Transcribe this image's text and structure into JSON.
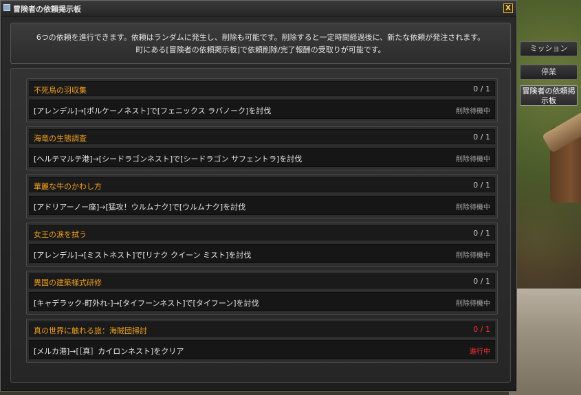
{
  "window": {
    "title": "冒険者の依頼掲示板",
    "close_label": "X"
  },
  "info": {
    "line1": "6つの依頼を進行できます。依頼はランダムに発生し、削除も可能です。削除すると一定時間経過後に、新たな依頼が発注されます。",
    "line2": "町にある[冒険者の依頼掲示板]で依頼削除/完了報酬の受取りが可能です。"
  },
  "quests": [
    {
      "title": "不死鳥の羽収集",
      "count": "0 / 1",
      "desc": "[アレンデル]→[ボルケーノネスト]で[フェニックス ラバノーク]を討伐",
      "status": "削除待機中"
    },
    {
      "title": "海竜の生態調査",
      "count": "0 / 1",
      "desc": "[ヘルテマルテ港]→[シードラゴンネスト]で[シードラゴン サフェントラ]を討伐",
      "status": "削除待機中"
    },
    {
      "title": "華麗な牛のかわし方",
      "count": "0 / 1",
      "desc": "[アドリアーノー座]→[猛攻！ウルムナク]で[ウルムナク]を討伐",
      "status": "削除待機中"
    },
    {
      "title": "女王の涙を拭う",
      "count": "0 / 1",
      "desc": "[アレンデル]→[ミストネスト]で[リナク クイーン ミスト]を討伐",
      "status": "削除待機中"
    },
    {
      "title": "異国の建築様式研修",
      "count": "0 / 1",
      "desc": "[キャデラック-町外れ-]→[タイフーンネスト]で[タイフーン]を討伐",
      "status": "削除待機中"
    },
    {
      "title": "真の世界に触れる旅：海賊団掃討",
      "count": "0 / 1",
      "desc": "[メルカ港]→[［真］カイロンネスト]をクリア",
      "status": "進行中"
    }
  ],
  "tabs": {
    "mission": "ミッション",
    "business": "停業",
    "board": "冒険者の依頼掲示板"
  },
  "colors": {
    "quest_title": "#f0a020",
    "in_progress": "#ff3030"
  }
}
